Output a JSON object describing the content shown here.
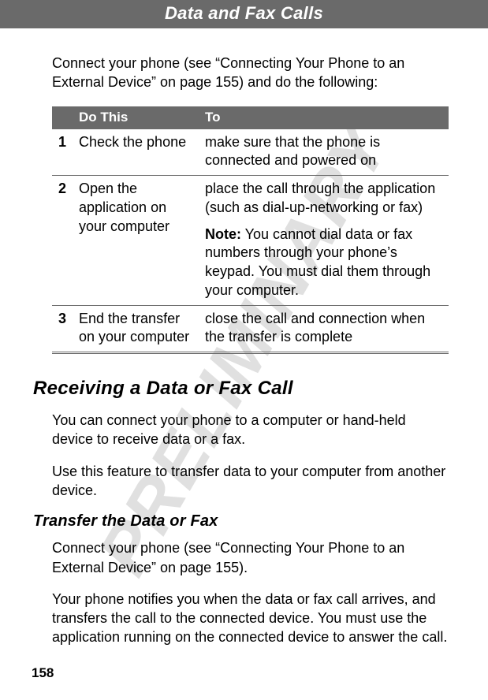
{
  "watermark": "PRELIMINARY",
  "header": {
    "title": "Data and Fax Calls"
  },
  "intro": "Connect your phone (see “Connecting Your Phone to an External Device” on page 155) and do the following:",
  "table": {
    "headers": {
      "num": "",
      "do": "Do This",
      "to": "To"
    },
    "rows": [
      {
        "num": "1",
        "do": "Check the phone",
        "to": "make sure that the phone is connected and powered on",
        "note_label": "",
        "note_text": ""
      },
      {
        "num": "2",
        "do": "Open the application on your computer",
        "to": "place the call through the application (such as dial-up-networking or fax)",
        "note_label": "Note:",
        "note_text": " You cannot dial data or fax numbers through your phone’s keypad. You must dial them through your computer."
      },
      {
        "num": "3",
        "do": "End the transfer on your computer",
        "to": "close the call and connection when the transfer is complete",
        "note_label": "",
        "note_text": ""
      }
    ]
  },
  "section": {
    "heading": "Receiving a Data or Fax Call",
    "p1": "You can connect your phone to a computer or hand-held device to receive data or a fax.",
    "p2": "Use this feature to transfer data to your computer from another device.",
    "subheading": "Transfer the Data or Fax",
    "p3": "Connect your phone (see “Connecting Your Phone to an External Device” on page 155).",
    "p4": "Your phone notifies you when the data or fax call arrives, and transfers the call to the connected device. You must use the application running on the connected device to answer the call."
  },
  "page_number": "158"
}
